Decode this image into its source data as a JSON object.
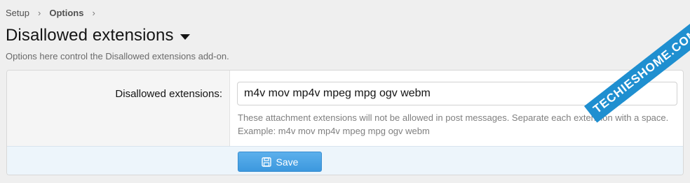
{
  "breadcrumb": {
    "items": [
      "Setup",
      "Options"
    ],
    "separator": "›"
  },
  "header": {
    "title": "Disallowed extensions",
    "description": "Options here control the Disallowed extensions add-on."
  },
  "option": {
    "label": "Disallowed extensions:",
    "value": "m4v mov mp4v mpeg mpg ogv webm",
    "hint_line1": "These attachment extensions will not be allowed in post messages. Separate each extension with a space.",
    "hint_line2": "Example: m4v mov mp4v mpeg mpg ogv webm"
  },
  "footer": {
    "save_label": "Save",
    "save_icon": "save-icon"
  },
  "watermark": {
    "text": "TECHIESHOME.COM"
  },
  "colors": {
    "accent": "#47a7eb",
    "footer_bg": "#edf5fb",
    "watermark": "#1f8fd0"
  }
}
